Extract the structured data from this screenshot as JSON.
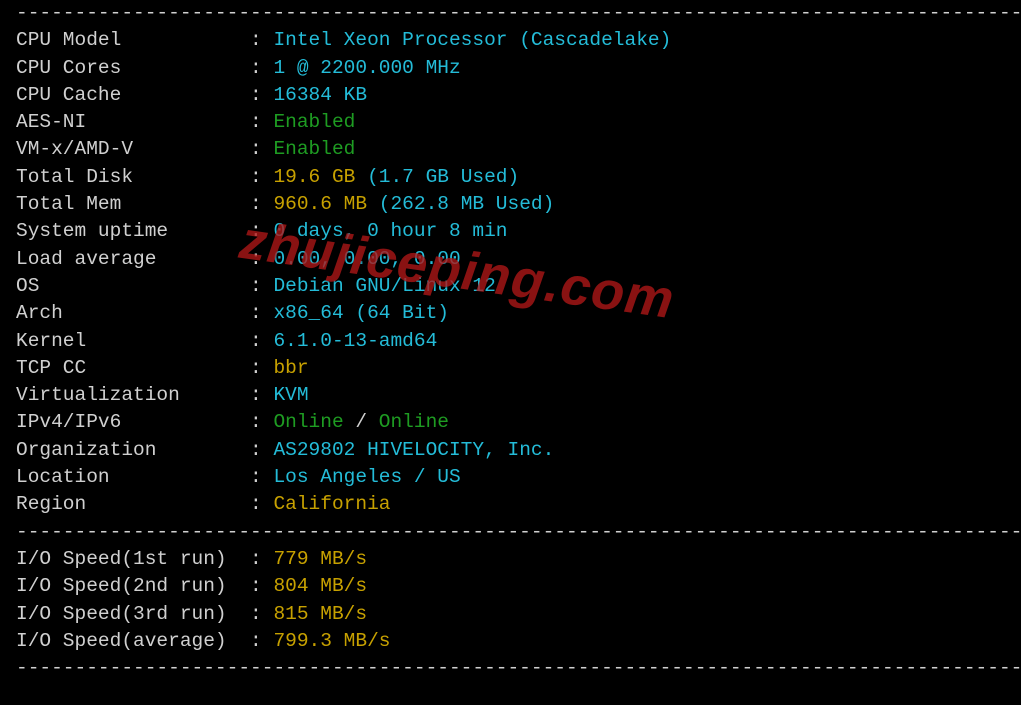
{
  "dashes": "----------------------------------------------------------------------------------------------------",
  "rows": [
    {
      "label": "CPU Model",
      "value": [
        {
          "t": "Intel Xeon Processor (Cascadelake)",
          "c": "cyan"
        }
      ]
    },
    {
      "label": "CPU Cores",
      "value": [
        {
          "t": "1 @ 2200.000 MHz",
          "c": "cyan"
        }
      ]
    },
    {
      "label": "CPU Cache",
      "value": [
        {
          "t": "16384 KB",
          "c": "cyan"
        }
      ]
    },
    {
      "label": "AES-NI",
      "value": [
        {
          "t": "Enabled",
          "c": "green"
        }
      ]
    },
    {
      "label": "VM-x/AMD-V",
      "value": [
        {
          "t": "Enabled",
          "c": "green"
        }
      ]
    },
    {
      "label": "Total Disk",
      "value": [
        {
          "t": "19.6 GB",
          "c": "yellow"
        },
        {
          "t": " ",
          "c": "white"
        },
        {
          "t": "(1.7 GB Used)",
          "c": "cyan"
        }
      ]
    },
    {
      "label": "Total Mem",
      "value": [
        {
          "t": "960.6 MB",
          "c": "yellow"
        },
        {
          "t": " ",
          "c": "white"
        },
        {
          "t": "(262.8 MB Used)",
          "c": "cyan"
        }
      ]
    },
    {
      "label": "System uptime",
      "value": [
        {
          "t": "0 days, 0 hour 8 min",
          "c": "cyan"
        }
      ]
    },
    {
      "label": "Load average",
      "value": [
        {
          "t": "0.00, 0.00, 0.00",
          "c": "cyan"
        }
      ]
    },
    {
      "label": "OS",
      "value": [
        {
          "t": "Debian GNU/Linux 12",
          "c": "cyan"
        }
      ]
    },
    {
      "label": "Arch",
      "value": [
        {
          "t": "x86_64 (64 Bit)",
          "c": "cyan"
        }
      ]
    },
    {
      "label": "Kernel",
      "value": [
        {
          "t": "6.1.0-13-amd64",
          "c": "cyan"
        }
      ]
    },
    {
      "label": "TCP CC",
      "value": [
        {
          "t": "bbr",
          "c": "yellow"
        }
      ]
    },
    {
      "label": "Virtualization",
      "value": [
        {
          "t": "KVM",
          "c": "cyan"
        }
      ]
    },
    {
      "label": "IPv4/IPv6",
      "value": [
        {
          "t": "Online",
          "c": "green"
        },
        {
          "t": " / ",
          "c": "white"
        },
        {
          "t": "Online",
          "c": "green"
        }
      ]
    },
    {
      "label": "Organization",
      "value": [
        {
          "t": "AS29802 HIVELOCITY, Inc.",
          "c": "cyan"
        }
      ]
    },
    {
      "label": "Location",
      "value": [
        {
          "t": "Los Angeles / US",
          "c": "cyan"
        }
      ]
    },
    {
      "label": "Region",
      "value": [
        {
          "t": "California",
          "c": "yellow"
        }
      ]
    }
  ],
  "io_rows": [
    {
      "label": "I/O Speed(1st run)",
      "value": [
        {
          "t": "779 MB/s",
          "c": "yellow"
        }
      ]
    },
    {
      "label": "I/O Speed(2nd run)",
      "value": [
        {
          "t": "804 MB/s",
          "c": "yellow"
        }
      ]
    },
    {
      "label": "I/O Speed(3rd run)",
      "value": [
        {
          "t": "815 MB/s",
          "c": "yellow"
        }
      ]
    },
    {
      "label": "I/O Speed(average)",
      "value": [
        {
          "t": "799.3 MB/s",
          "c": "yellow"
        }
      ]
    }
  ],
  "watermark": "zhujiceping.com",
  "label_width": 19
}
